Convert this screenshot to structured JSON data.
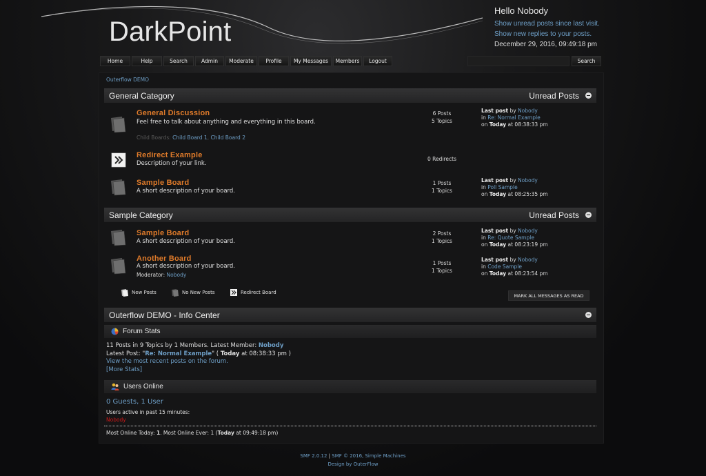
{
  "header": {
    "logo": "DarkPoint",
    "greeting": "Hello Nobody",
    "unread_since_link": "Show unread posts since last visit.",
    "new_replies_link": "Show new replies to your posts.",
    "date": "December 29, 2016, 09:49:18 pm"
  },
  "nav": {
    "items": [
      "Home",
      "Help",
      "Search",
      "Admin",
      "Moderate",
      "Profile",
      "My Messages",
      "Members",
      "Logout"
    ],
    "search_value": "",
    "search_button": "Search"
  },
  "breadcrumb": "Outerflow DEMO",
  "categories": [
    {
      "title": "General Category",
      "unread": "Unread Posts",
      "boards": [
        {
          "name": "General Discussion",
          "description": "Feel free to talk about anything and everything in this board.",
          "child_label": "Child Boards:",
          "children": [
            "Child Board 1",
            "Child Board 2"
          ],
          "posts": "6 Posts",
          "topics": "5 Topics",
          "last_label": "Last post",
          "by": "by",
          "author": "Nobody",
          "in": "in",
          "topic": "Re: Normal Example",
          "on": "on",
          "day": "Today",
          "time": "at 08:38:33 pm"
        },
        {
          "name": "Redirect Example",
          "description": "Description of your link.",
          "redirects": "0 Redirects"
        },
        {
          "name": "Sample Board",
          "description": "A short description of your board.",
          "posts": "1 Posts",
          "topics": "1 Topics",
          "last_label": "Last post",
          "by": "by",
          "author": "Nobody",
          "in": "in",
          "topic": "Poll Sample",
          "on": "on",
          "day": "Today",
          "time": "at 08:25:35 pm"
        }
      ]
    },
    {
      "title": "Sample Category",
      "unread": "Unread Posts",
      "boards": [
        {
          "name": "Sample Board",
          "description": "A short description of your board.",
          "posts": "2 Posts",
          "topics": "1 Topics",
          "last_label": "Last post",
          "by": "by",
          "author": "Nobody",
          "in": "in",
          "topic": "Re: Quote Sample",
          "on": "on",
          "day": "Today",
          "time": "at 08:23:19 pm"
        },
        {
          "name": "Another Board",
          "description": "A short description of your board.",
          "moderator_label": "Moderator:",
          "moderator": "Nobody",
          "posts": "1 Posts",
          "topics": "1 Topics",
          "last_label": "Last post",
          "by": "by",
          "author": "Nobody",
          "in": "in",
          "topic": "Code Sample",
          "on": "on",
          "day": "Today",
          "time": "at 08:23:54 pm"
        }
      ]
    }
  ],
  "legend": {
    "new_posts": "New Posts",
    "no_new_posts": "No New Posts",
    "redirect_board": "Redirect Board",
    "mark_all_read": "MARK ALL MESSAGES AS READ"
  },
  "info_center": {
    "title": "Outerflow DEMO - Info Center",
    "forum_stats_title": "Forum Stats",
    "stats_text": "11 Posts in 9 Topics by 1 Members. Latest Member:",
    "latest_member": "Nobody",
    "latest_post_label": "Latest Post: \"",
    "latest_post_topic": "Re: Normal Example",
    "latest_post_mid": "\" (",
    "latest_post_day": "Today",
    "latest_post_time": "at 08:38:33 pm )",
    "recent_posts_link": "View the most recent posts on the forum.",
    "more_stats_link": "[More Stats]",
    "users_online_title": "Users Online",
    "guests_users": "0 Guests, 1 User",
    "active_label": "Users active in past 15 minutes:",
    "active_user": "Nobody",
    "most_online_label": "Most Online Today:",
    "most_online_today": "1",
    "most_online_ever_label": ". Most Online Ever: 1 (",
    "most_online_ever_day": "Today",
    "most_online_ever_time": "at 09:49:18 pm)"
  },
  "footer": {
    "smf_version": "SMF 2.0.12",
    "separator": "|",
    "copyright": "SMF © 2016, Simple Machines",
    "design": "Design by OuterFlow"
  }
}
